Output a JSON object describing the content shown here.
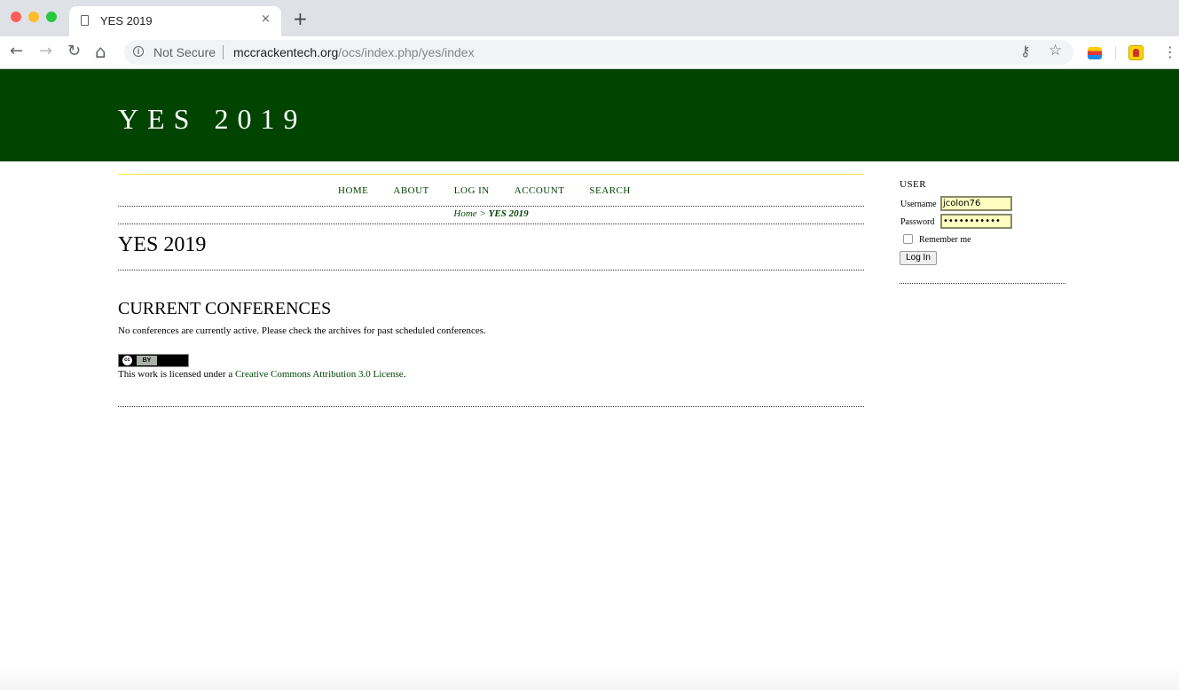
{
  "browser": {
    "tab_title": "YES 2019",
    "tab_close": "×",
    "new_tab": "+",
    "security_label": "Not Secure",
    "url_host": "mccrackentech.org",
    "url_path": "/ocs/index.php/yes/index",
    "nav_icons": {
      "back": "←",
      "forward": "→",
      "reload": "↻",
      "home": "⌂"
    },
    "omnibox_icons": {
      "key": "key-icon",
      "star": "☆"
    },
    "menu": "⋮"
  },
  "site": {
    "title": "YES 2019",
    "header_color": "#004400",
    "accent_color": "#ffe33b"
  },
  "nav": {
    "items": [
      "HOME",
      "ABOUT",
      "LOG IN",
      "ACCOUNT",
      "SEARCH"
    ]
  },
  "breadcrumb": {
    "home": "Home",
    "separator": " > ",
    "current": "YES 2019"
  },
  "main": {
    "page_title": "YES 2019",
    "section_title": "CURRENT CONFERENCES",
    "no_conferences_text": "No conferences are currently active. Please check the archives for past scheduled conferences.",
    "cc_badge": {
      "cc": "cc",
      "by": "BY"
    },
    "license_prefix": "This work is licensed under a ",
    "license_link": "Creative Commons Attribution 3.0 License",
    "license_suffix": "."
  },
  "sidebar": {
    "user_title": "USER",
    "username_label": "Username",
    "username_value": "jcolon76",
    "password_label": "Password",
    "password_value": "•••••••••••",
    "remember_label": "Remember me",
    "login_button": "Log In"
  }
}
